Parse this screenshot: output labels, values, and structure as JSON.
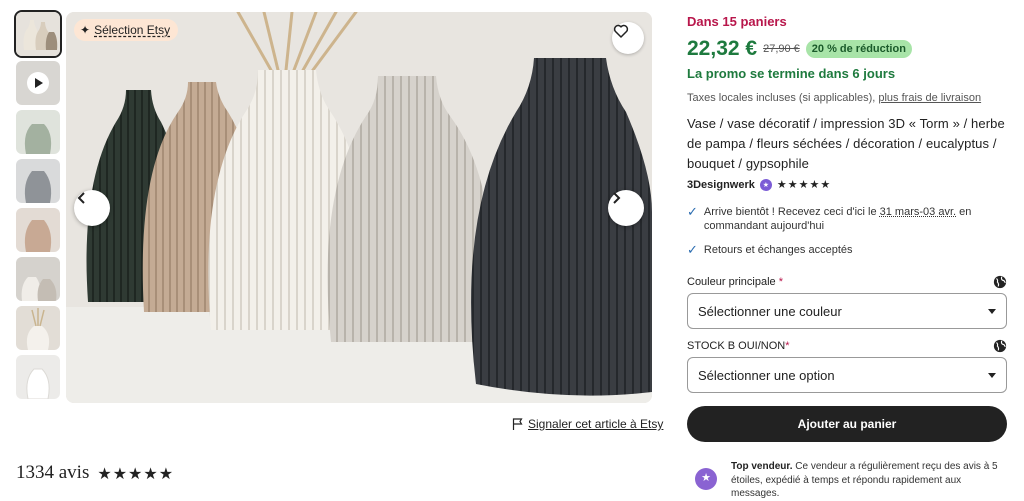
{
  "gallery": {
    "badge_label": "Sélection Etsy",
    "thumbnails": [
      {
        "name": "thumb-1",
        "color": "#d9d4cc"
      },
      {
        "name": "thumb-2",
        "color": "#c8c2b8"
      },
      {
        "name": "thumb-3",
        "color": "#a9b4a6"
      },
      {
        "name": "thumb-4",
        "color": "#9a9da0"
      },
      {
        "name": "thumb-5",
        "color": "#cdb3a2"
      },
      {
        "name": "thumb-6",
        "color": "#cfcac4"
      },
      {
        "name": "thumb-7",
        "color": "#d4cfc8"
      },
      {
        "name": "thumb-8",
        "color": "#e3e1de"
      }
    ],
    "report_label": "Signaler cet article à Etsy"
  },
  "reviews": {
    "count_label": "1334 avis",
    "stars": "★★★★★"
  },
  "product": {
    "in_carts": "Dans 15 paniers",
    "price": "22,32 €",
    "old_price": "27,90 €",
    "discount": "20 % de réduction",
    "promo_end": "La promo se termine dans 6 jours",
    "taxes_text": "Taxes locales incluses (si applicables),",
    "shipping_link": "plus frais de livraison",
    "title": "Vase / vase décoratif / impression 3D « Torm » / herbe de pampa / fleurs séchées / décoration / eucalyptus / bouquet / gypsophile",
    "seller_name": "3Designwerk",
    "seller_stars": "★★★★★",
    "arrival_prefix": "Arrive bientôt ! Recevez ceci d'ici le",
    "arrival_dates": "31 mars-03 avr.",
    "arrival_suffix": "en commandant aujourd'hui",
    "returns": "Retours et échanges acceptés",
    "color_label": "Couleur principale",
    "color_placeholder": "Sélectionner une couleur",
    "stock_label": "STOCK B OUI/NON",
    "stock_placeholder": "Sélectionner une option",
    "required_mark": "*",
    "add_to_cart": "Ajouter au panier",
    "top_seller_title": "Top vendeur.",
    "top_seller_text": "Ce vendeur a régulièrement reçu des avis à 5 étoiles, expédié à temps et répondu rapidement aux messages."
  },
  "colors": {
    "accent_green": "#1e7a3e",
    "cart_red": "#b8164b",
    "discount_bg": "#a8e4a8",
    "button_dark": "#222222"
  }
}
